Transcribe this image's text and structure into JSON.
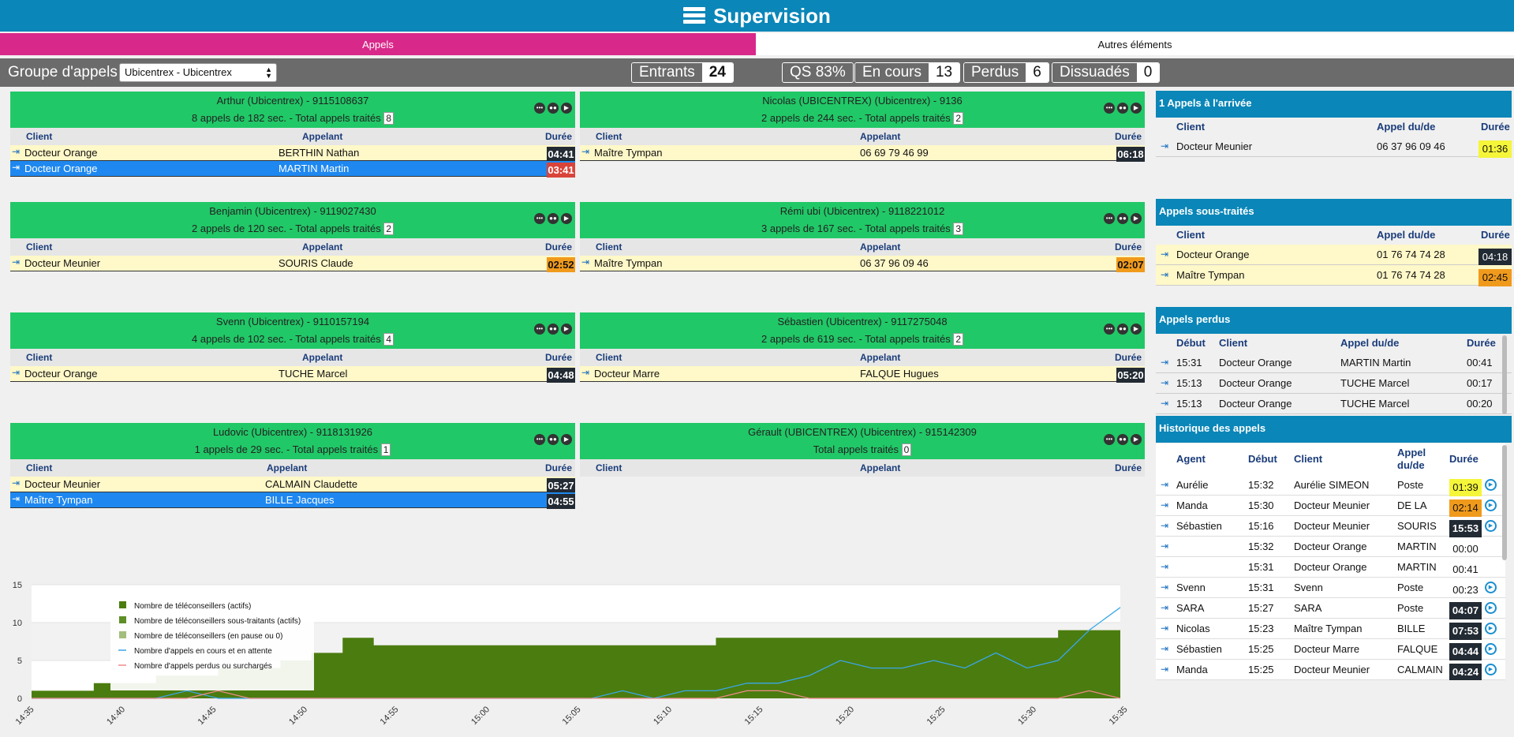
{
  "header": {
    "title": "Supervision"
  },
  "tabs": {
    "appels": "Appels",
    "autres": "Autres éléments"
  },
  "toolbar": {
    "group_label": "Groupe d'appels",
    "group_value": "Ubicentrex - Ubicentrex"
  },
  "stats": {
    "entrants_k": "Entrants",
    "entrants_v": "24",
    "qs": "QS 83%",
    "encours_k": "En cours",
    "encours_v": "13",
    "perdus_k": "Perdus",
    "perdus_v": "6",
    "dissuades_k": "Dissuadés",
    "dissuades_v": "0"
  },
  "cols": {
    "client": "Client",
    "appelant": "Appelant",
    "duree": "Durée",
    "appel_dude": "Appel du/de",
    "debut": "Début",
    "agent": "Agent",
    "appel": "Appel",
    "dude": "du/de"
  },
  "agents": [
    {
      "name": "Arthur (Ubicentrex) - 9115108637",
      "summary": "8 appels de 182 sec. - Total appels traités",
      "total": "8",
      "rows": [
        {
          "client": "Docteur Orange",
          "appelant": "BERTHIN Nathan",
          "duree": "04:41"
        },
        {
          "client": "Docteur Orange",
          "appelant": "MARTIN Martin",
          "duree": "03:41"
        }
      ]
    },
    {
      "name": "Nicolas (UBICENTREX) (Ubicentrex) - 9136",
      "summary": "2 appels de 244 sec. - Total appels traités",
      "total": "2",
      "rows": [
        {
          "client": "Maître Tympan",
          "appelant": "06 69 79 46 99",
          "duree": "06:18"
        }
      ]
    },
    {
      "name": "Benjamin (Ubicentrex) - 9119027430",
      "summary": "2 appels de 120 sec. - Total appels traités",
      "total": "2",
      "rows": [
        {
          "client": "Docteur Meunier",
          "appelant": "SOURIS Claude",
          "duree": "02:52"
        }
      ]
    },
    {
      "name": "Rémi ubi (Ubicentrex) - 9118221012",
      "summary": "3 appels de 167 sec. - Total appels traités",
      "total": "3",
      "rows": [
        {
          "client": "Maître Tympan",
          "appelant": "06 37 96 09 46",
          "duree": "02:07"
        }
      ]
    },
    {
      "name": "Svenn (Ubicentrex) - 9110157194",
      "summary": "4 appels de 102 sec. - Total appels traités",
      "total": "4",
      "rows": [
        {
          "client": "Docteur Orange",
          "appelant": "TUCHE Marcel",
          "duree": "04:48"
        }
      ]
    },
    {
      "name": "Sébastien (Ubicentrex) - 9117275048",
      "summary": "2 appels de 619 sec. - Total appels traités",
      "total": "2",
      "rows": [
        {
          "client": "Docteur Marre",
          "appelant": "FALQUE Hugues",
          "duree": "05:20"
        }
      ]
    },
    {
      "name": "Ludovic (Ubicentrex) - 9118131926",
      "summary": "1 appels de 29 sec. - Total appels traités",
      "total": "1",
      "rows": [
        {
          "client": "Docteur Meunier",
          "appelant": "CALMAIN Claudette",
          "duree": "05:27"
        },
        {
          "client": "Maître Tympan",
          "appelant": "BILLE Jacques",
          "duree": "04:55"
        }
      ]
    },
    {
      "name": "Gérault (UBICENTREX) (Ubicentrex) - 915142309",
      "summary": "Total appels traités",
      "total": "0",
      "rows": []
    }
  ],
  "arrivee": {
    "title": "1 Appels à l'arrivée",
    "rows": [
      {
        "client": "Docteur Meunier",
        "num": "06 37 96 09 46",
        "duree": "01:36"
      }
    ]
  },
  "soustraites": {
    "title": "Appels sous-traités",
    "rows": [
      {
        "client": "Docteur Orange",
        "num": "01 76 74 74 28",
        "duree": "04:18"
      },
      {
        "client": "Maître Tympan",
        "num": "01 76 74 74 28",
        "duree": "02:45"
      }
    ]
  },
  "perdus": {
    "title": "Appels perdus",
    "rows": [
      {
        "debut": "15:31",
        "client": "Docteur Orange",
        "num": "MARTIN Martin",
        "duree": "00:41"
      },
      {
        "debut": "15:13",
        "client": "Docteur Orange",
        "num": "TUCHE Marcel",
        "duree": "00:17"
      },
      {
        "debut": "15:13",
        "client": "Docteur Orange",
        "num": "TUCHE Marcel",
        "duree": "00:20"
      }
    ]
  },
  "historique": {
    "title": "Historique des appels",
    "rows": [
      {
        "agent": "Aurélie",
        "debut": "15:32",
        "client": "Aurélie SIMEON",
        "num": "Poste",
        "duree": "01:39",
        "style": "yellow",
        "play": true
      },
      {
        "agent": "Manda",
        "debut": "15:30",
        "client": "Docteur Meunier",
        "num": "DE LA",
        "duree": "02:14",
        "style": "orange",
        "play": true
      },
      {
        "agent": "Sébastien",
        "debut": "15:16",
        "client": "Docteur Meunier",
        "num": "SOURIS",
        "duree": "15:53",
        "style": "dark",
        "play": true
      },
      {
        "agent": "",
        "debut": "15:32",
        "client": "Docteur Orange",
        "num": "MARTIN",
        "duree": "00:00",
        "style": "",
        "play": false
      },
      {
        "agent": "",
        "debut": "15:31",
        "client": "Docteur Orange",
        "num": "MARTIN",
        "duree": "00:41",
        "style": "",
        "play": false
      },
      {
        "agent": "Svenn",
        "debut": "15:31",
        "client": "Svenn",
        "num": "Poste",
        "duree": "00:23",
        "style": "",
        "play": true
      },
      {
        "agent": "SARA",
        "debut": "15:27",
        "client": "SARA",
        "num": "Poste",
        "duree": "04:07",
        "style": "dark",
        "play": true
      },
      {
        "agent": "Nicolas",
        "debut": "15:23",
        "client": "Maître Tympan",
        "num": "BILLE",
        "duree": "07:53",
        "style": "dark",
        "play": true
      },
      {
        "agent": "Sébastien",
        "debut": "15:25",
        "client": "Docteur Marre",
        "num": "FALQUE",
        "duree": "04:44",
        "style": "dark",
        "play": true
      },
      {
        "agent": "Manda",
        "debut": "15:25",
        "client": "Docteur Meunier",
        "num": "CALMAIN",
        "duree": "04:24",
        "style": "dark",
        "play": true
      }
    ]
  },
  "colors": {
    "actifs": "#4b7c0f",
    "soustraitants": "#5e8e26",
    "pause": "#a3be7c",
    "encours": "#3aa7e8",
    "perdus": "#f08a8a"
  },
  "chart_data": {
    "type": "area",
    "x": [
      "14:35",
      "14:37",
      "14:38",
      "14:40",
      "14:42",
      "14:44",
      "14:45",
      "14:46",
      "14:48",
      "14:50",
      "14:51",
      "14:53",
      "14:55",
      "14:57",
      "14:59",
      "15:00",
      "15:02",
      "15:04",
      "15:05",
      "15:07",
      "15:09",
      "15:10",
      "15:12",
      "15:14",
      "15:16",
      "15:18",
      "15:19",
      "15:21",
      "15:23",
      "15:24",
      "15:26",
      "15:28",
      "15:30",
      "15:31",
      "15:33",
      "15:35"
    ],
    "yticks": [
      0,
      5,
      10,
      15
    ],
    "ylim": [
      0,
      15
    ],
    "xticks": [
      "14:35",
      "14:40",
      "14:45",
      "14:50",
      "14:55",
      "15:00",
      "15:05",
      "15:10",
      "15:15",
      "15:20",
      "15:25",
      "15:30",
      "15:35"
    ],
    "series": [
      {
        "name": "Nombre de téléconseillers (actifs)",
        "values": [
          1,
          1,
          2,
          2,
          3,
          3,
          4,
          4,
          5,
          6,
          8,
          7,
          7,
          7,
          7,
          7,
          7,
          7,
          7,
          7,
          7,
          7,
          8,
          8,
          8,
          8,
          8,
          8,
          8,
          8,
          8,
          8,
          8,
          9,
          9,
          9
        ]
      },
      {
        "name": "Nombre de téléconseillers sous-traitants (actifs)",
        "values": [
          0,
          0,
          0,
          0,
          0,
          0,
          0,
          0,
          0,
          0,
          0,
          0,
          0,
          0,
          0,
          0,
          0,
          0,
          0,
          0,
          0,
          0,
          0,
          0,
          0,
          0,
          0,
          0,
          0,
          0,
          0,
          0,
          0,
          0,
          0,
          0
        ]
      },
      {
        "name": "Nombre de téléconseillers (en pause ou 0)",
        "values": [
          0,
          0,
          0,
          0,
          0,
          0,
          0,
          0,
          0,
          0,
          0,
          0,
          0,
          0,
          0,
          0,
          0,
          0,
          0,
          0,
          0,
          0,
          0,
          0,
          0,
          0,
          0,
          0,
          0,
          0,
          0,
          0,
          0,
          0,
          0,
          0
        ]
      },
      {
        "name": "Nombre d'appels en cours et en attente",
        "values": [
          0,
          0,
          0,
          0,
          0,
          1,
          0,
          0,
          0,
          0,
          0,
          0,
          0,
          0,
          0,
          0,
          0,
          0,
          0,
          1,
          0,
          1,
          1,
          2,
          2,
          3,
          5,
          4,
          4,
          5,
          4,
          6,
          4,
          5,
          9,
          12
        ]
      },
      {
        "name": "Nombre d'appels perdus ou surchargés",
        "values": [
          0,
          0,
          0,
          0,
          0,
          0,
          1,
          0,
          0,
          0,
          0,
          0,
          0,
          0,
          0,
          0,
          0,
          0,
          0,
          0,
          0,
          0,
          0,
          1,
          1,
          0,
          0,
          0,
          0,
          0,
          0,
          0,
          0,
          0,
          1,
          0
        ]
      }
    ]
  }
}
